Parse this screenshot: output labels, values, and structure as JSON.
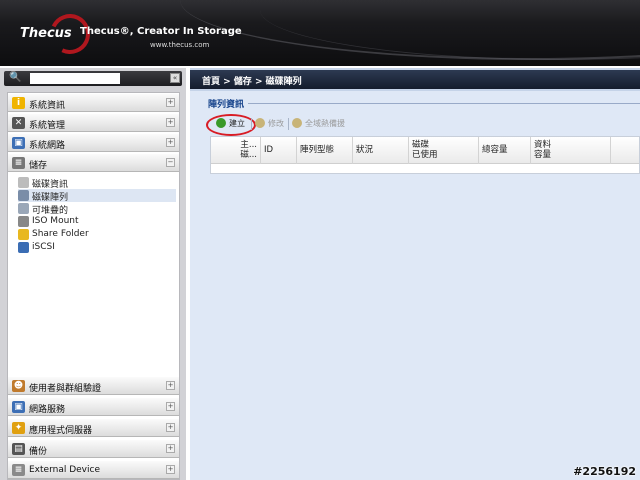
{
  "header": {
    "logo_text": "Thecus",
    "tagline": "Thecus®, Creator In Storage",
    "url": "www.thecus.com"
  },
  "sidebar": {
    "search_value": "",
    "collapse_symbol": "«",
    "sections_top": [
      {
        "label": "系統資訊",
        "icon": "info-icon",
        "toggle": "+",
        "color": "#e8a800"
      },
      {
        "label": "系統管理",
        "icon": "tools-icon",
        "toggle": "+",
        "color": "#444"
      },
      {
        "label": "系統網路",
        "icon": "network-icon",
        "toggle": "+",
        "color": "#3d6fb5"
      },
      {
        "label": "儲存",
        "icon": "storage-icon",
        "toggle": "−",
        "color": "#666"
      }
    ],
    "storage_items": [
      {
        "label": "磁碟資訊",
        "icon": "disk-info-icon",
        "selected": false
      },
      {
        "label": "磁碟陣列",
        "icon": "raid-icon",
        "selected": true
      },
      {
        "label": "可堆疊的",
        "icon": "stackable-icon",
        "selected": false
      },
      {
        "label": "ISO Mount",
        "icon": "iso-mount-icon",
        "selected": false
      },
      {
        "label": "Share Folder",
        "icon": "share-folder-icon",
        "selected": false
      },
      {
        "label": "iSCSI",
        "icon": "iscsi-icon",
        "selected": false
      }
    ],
    "sections_bottom": [
      {
        "label": "使用者與群組驗證",
        "icon": "users-icon",
        "toggle": "+"
      },
      {
        "label": "網路服務",
        "icon": "network-service-icon",
        "toggle": "+"
      },
      {
        "label": "應用程式伺服器",
        "icon": "app-server-icon",
        "toggle": "+"
      },
      {
        "label": "備份",
        "icon": "backup-icon",
        "toggle": "+"
      },
      {
        "label": "External Device",
        "icon": "external-device-icon",
        "toggle": "+"
      }
    ]
  },
  "breadcrumb": "首頁 > 儲存 > 磁碟陣列",
  "panel": {
    "title": "陣列資訊",
    "toolbar": {
      "create": "建立",
      "edit": "修改",
      "global_hot_spare": "全域熱備援"
    },
    "columns": [
      {
        "lines": [
          "主...",
          "磁..."
        ]
      },
      {
        "lines": [
          "ID"
        ]
      },
      {
        "lines": [
          "陣列型態"
        ]
      },
      {
        "lines": [
          "狀況"
        ]
      },
      {
        "lines": [
          "磁碟",
          "已使用"
        ]
      },
      {
        "lines": [
          "總容量"
        ]
      },
      {
        "lines": [
          "資料",
          "容量"
        ]
      }
    ]
  },
  "watermark": "#2256192"
}
